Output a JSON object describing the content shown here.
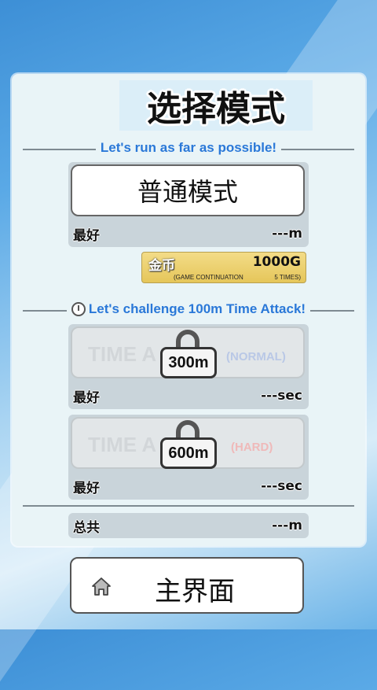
{
  "title": "选择模式",
  "normal_section": {
    "tagline": "Let's run as far as possible!",
    "button_label": "普通模式",
    "best_label": "最好",
    "best_value": "---m",
    "coin": {
      "label": "金币",
      "amount": "1000G",
      "note": "(GAME CONTINUATION",
      "times": "5 TIMES)"
    }
  },
  "time_attack_section": {
    "tagline": "Let's challenge 100m Time Attack!",
    "modes": [
      {
        "label": "TIME A",
        "lock_label": "300m",
        "mode": "(NORMAL)",
        "mode_color": "#b9c8e6",
        "best_label": "最好",
        "best_value": "---sec"
      },
      {
        "label": "TIME A",
        "lock_label": "600m",
        "mode": "(HARD)",
        "mode_color": "#efb9b9",
        "best_label": "最好",
        "best_value": "---sec"
      }
    ]
  },
  "total": {
    "label": "总共",
    "value": "---m"
  },
  "home_button": {
    "label": "主界面",
    "icon": "home-icon"
  }
}
